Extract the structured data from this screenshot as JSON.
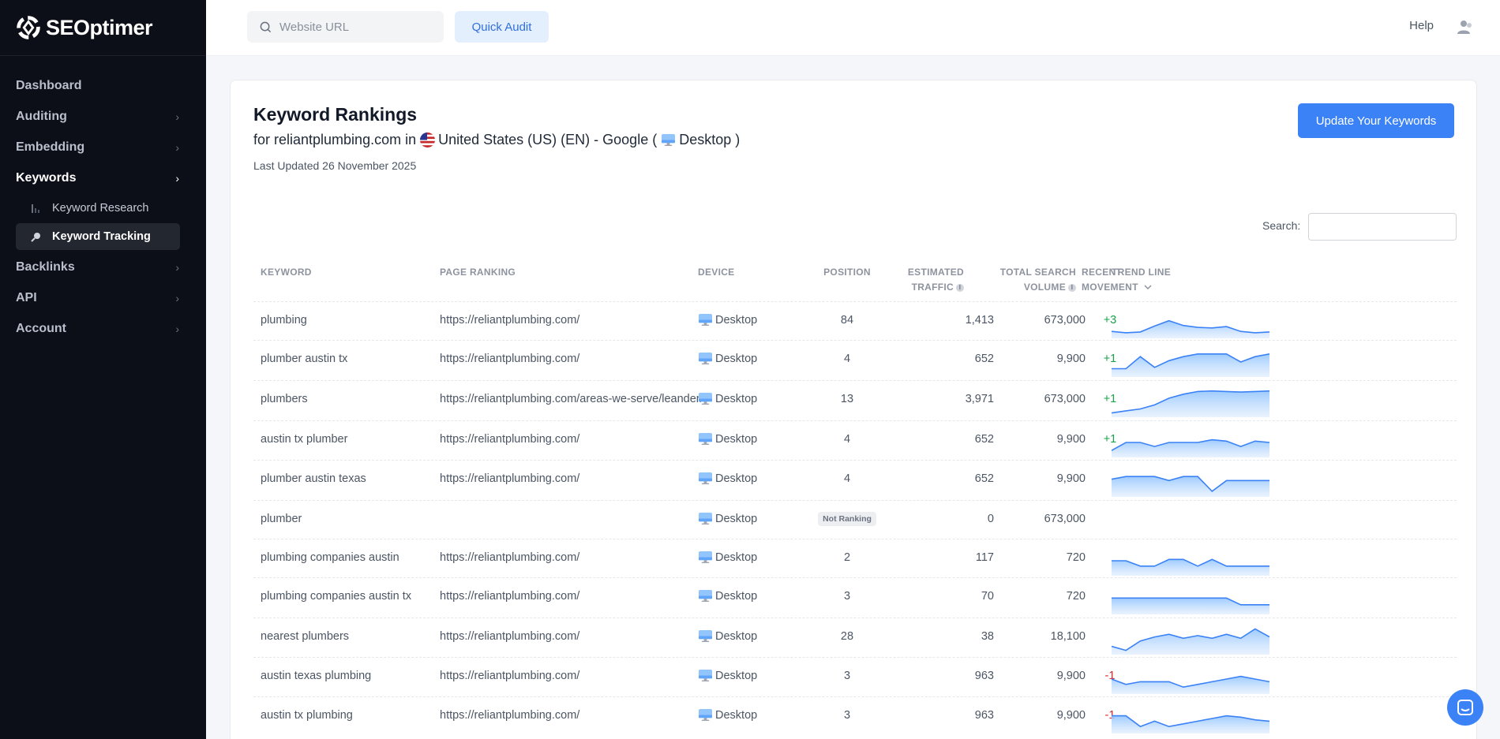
{
  "brand": {
    "name": "SEOptimer"
  },
  "topbar": {
    "search_placeholder": "Website URL",
    "quick_audit_label": "Quick Audit",
    "help_label": "Help"
  },
  "sidebar": {
    "items": [
      {
        "label": "Dashboard",
        "chevron": false,
        "active": false
      },
      {
        "label": "Auditing",
        "chevron": true,
        "active": false
      },
      {
        "label": "Embedding",
        "chevron": true,
        "active": false
      },
      {
        "label": "Keywords",
        "chevron": true,
        "active": true
      },
      {
        "label": "Backlinks",
        "chevron": true,
        "active": false
      },
      {
        "label": "API",
        "chevron": true,
        "active": false
      },
      {
        "label": "Account",
        "chevron": true,
        "active": false
      }
    ],
    "sub_items": [
      {
        "label": "Keyword Research",
        "icon": "bar-chart-icon",
        "active": false
      },
      {
        "label": "Keyword Tracking",
        "icon": "magnifier-icon",
        "active": true
      }
    ]
  },
  "page": {
    "title": "Keyword Rankings",
    "subtitle_prefix": "for reliantplumbing.com in",
    "subtitle_location": "United States (US) (EN) - Google (",
    "subtitle_device": "Desktop",
    "subtitle_suffix": ")",
    "last_updated": "Last Updated 26 November 2025",
    "update_button": "Update Your Keywords",
    "search_label": "Search:"
  },
  "table": {
    "headers": {
      "keyword": "KEYWORD",
      "page_ranking": "PAGE RANKING",
      "device": "DEVICE",
      "position": "POSITION",
      "traffic_1": "ESTIMATED",
      "traffic_2": "TRAFFIC",
      "volume_1": "TOTAL SEARCH",
      "volume_2": "VOLUME",
      "movement_1": "RECENT",
      "movement_2": "MOVEMENT",
      "trend": "TREND LINE"
    },
    "rows": [
      {
        "keyword": "plumbing",
        "page": "https://reliantplumbing.com/",
        "device": "Desktop",
        "position": "84",
        "traffic": "1,413",
        "volume": "673,000",
        "movement": "+3",
        "trend": [
          20,
          15,
          18,
          40,
          60,
          42,
          35,
          33,
          38,
          20,
          15,
          18
        ]
      },
      {
        "keyword": "plumber austin tx",
        "page": "https://reliantplumbing.com/",
        "device": "Desktop",
        "position": "4",
        "traffic": "652",
        "volume": "9,900",
        "movement": "+1",
        "trend": [
          25,
          25,
          70,
          30,
          55,
          70,
          80,
          80,
          80,
          50,
          70,
          80
        ]
      },
      {
        "keyword": "plumbers",
        "page": "https://reliantplumbing.com/areas-we-serve/leander/",
        "device": "Desktop",
        "position": "13",
        "traffic": "3,971",
        "volume": "673,000",
        "movement": "+1",
        "trend": [
          10,
          18,
          25,
          40,
          65,
          80,
          90,
          92,
          90,
          88,
          90,
          92
        ]
      },
      {
        "keyword": "austin tx plumber",
        "page": "https://reliantplumbing.com/",
        "device": "Desktop",
        "position": "4",
        "traffic": "652",
        "volume": "9,900",
        "movement": "+1",
        "trend": [
          20,
          50,
          50,
          35,
          50,
          50,
          50,
          60,
          55,
          35,
          55,
          50
        ]
      },
      {
        "keyword": "plumber austin texas",
        "page": "https://reliantplumbing.com/",
        "device": "Desktop",
        "position": "4",
        "traffic": "652",
        "volume": "9,900",
        "movement": "",
        "trend": [
          60,
          70,
          70,
          70,
          55,
          70,
          70,
          15,
          55,
          55,
          55,
          55
        ]
      },
      {
        "keyword": "plumber",
        "page": "",
        "device": "Desktop",
        "position": "Not Ranking",
        "traffic": "0",
        "volume": "673,000",
        "movement": "",
        "trend": []
      },
      {
        "keyword": "plumbing companies austin",
        "page": "https://reliantplumbing.com/",
        "device": "Desktop",
        "position": "2",
        "traffic": "117",
        "volume": "720",
        "movement": "",
        "trend": [
          50,
          50,
          30,
          30,
          55,
          55,
          30,
          55,
          30,
          30,
          30,
          30
        ]
      },
      {
        "keyword": "plumbing companies austin tx",
        "page": "https://reliantplumbing.com/",
        "device": "Desktop",
        "position": "3",
        "traffic": "70",
        "volume": "720",
        "movement": "",
        "trend": [
          55,
          55,
          55,
          55,
          55,
          55,
          55,
          55,
          55,
          30,
          30,
          30
        ]
      },
      {
        "keyword": "nearest plumbers",
        "page": "https://reliantplumbing.com/",
        "device": "Desktop",
        "position": "28",
        "traffic": "38",
        "volume": "18,100",
        "movement": "",
        "trend": [
          25,
          10,
          45,
          60,
          70,
          55,
          65,
          55,
          70,
          55,
          90,
          60
        ]
      },
      {
        "keyword": "austin texas plumbing",
        "page": "https://reliantplumbing.com/",
        "device": "Desktop",
        "position": "3",
        "traffic": "963",
        "volume": "9,900",
        "movement": "-1",
        "trend": [
          50,
          30,
          40,
          40,
          40,
          20,
          30,
          40,
          50,
          60,
          50,
          40
        ]
      },
      {
        "keyword": "austin tx plumbing",
        "page": "https://reliantplumbing.com/",
        "device": "Desktop",
        "position": "3",
        "traffic": "963",
        "volume": "9,900",
        "movement": "-1",
        "trend": [
          60,
          60,
          20,
          40,
          20,
          30,
          40,
          50,
          60,
          55,
          45,
          40
        ]
      }
    ]
  },
  "colors": {
    "accent": "#3b82f6",
    "sidebar_bg": "#0c0f17",
    "positive": "#16a34a",
    "negative": "#dc2626"
  }
}
